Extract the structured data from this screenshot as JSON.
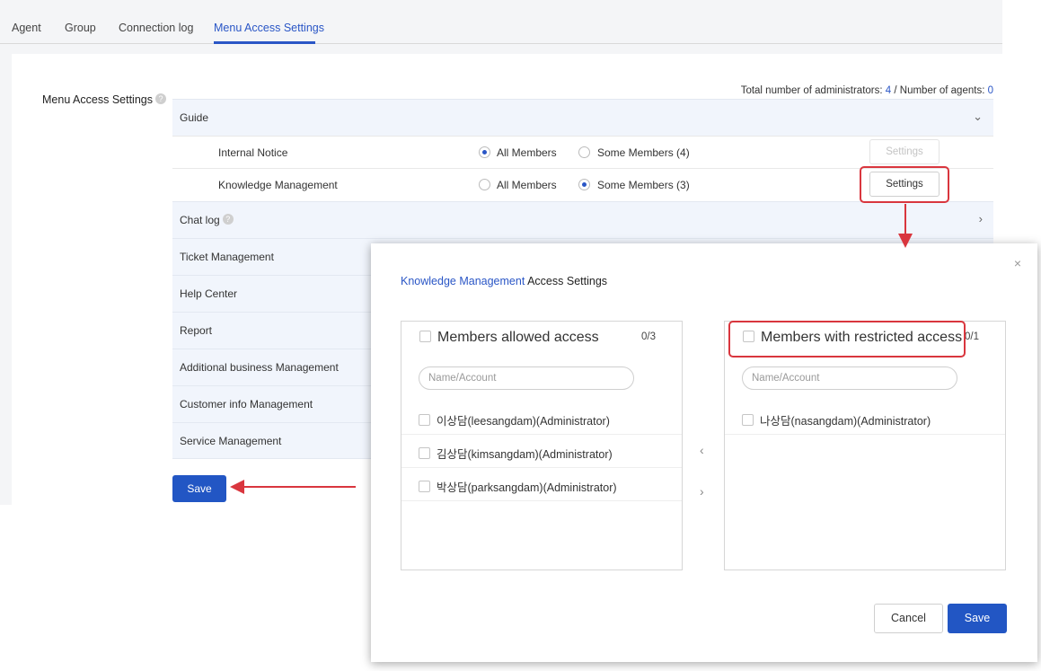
{
  "tabs": [
    "Agent",
    "Group",
    "Connection log",
    "Menu Access Settings"
  ],
  "section": {
    "title": "Menu Access Settings",
    "help": "?"
  },
  "totals": {
    "admins_label": "Total number of administrators:",
    "admins_value": "4",
    "separator": "/",
    "agents_label": "Number of agents:",
    "agents_value": "0"
  },
  "guide": {
    "label": "Guide",
    "items": [
      {
        "label": "Internal Notice",
        "all": "All Members",
        "some": "Some Members (4)",
        "selected": "all",
        "settings": "Settings"
      },
      {
        "label": "Knowledge Management",
        "all": "All Members",
        "some": "Some Members (3)",
        "selected": "some",
        "settings": "Settings"
      }
    ]
  },
  "menus": [
    "Chat log",
    "Ticket Management",
    "Help Center",
    "Report",
    "Additional business Management",
    "Customer info Management",
    "Service Management"
  ],
  "help_icon": "?",
  "save_label": "Save",
  "modal": {
    "title_highlight": "Knowledge Management",
    "title_rest": "Access Settings",
    "close": "×",
    "allowed": {
      "heading": "Members allowed access",
      "count": "0/3",
      "placeholder": "Name/Account",
      "members": [
        "이상담(leesangdam)(Administrator)",
        "김상담(kimsangdam)(Administrator)",
        "박상담(parksangdam)(Administrator)"
      ]
    },
    "restricted": {
      "heading": "Members with restricted access",
      "count": "0/1",
      "placeholder": "Name/Account",
      "members": [
        "나상담(nasangdam)(Administrator)"
      ]
    },
    "move_left": "‹",
    "move_right": "›",
    "cancel_label": "Cancel",
    "save_label": "Save"
  },
  "colors": {
    "accent": "#2a56c6",
    "primary_button": "#2256c4",
    "highlight": "#d9363e",
    "group_row": "#f1f5fc"
  },
  "icons": [
    "help-icon",
    "chevron-down-icon",
    "chevron-right-icon",
    "close-icon",
    "arrow-left-icon",
    "arrow-right-icon"
  ]
}
